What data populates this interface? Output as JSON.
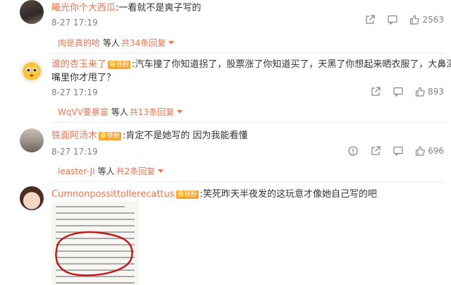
{
  "comments": [
    {
      "username": "曦光你个大西瓜",
      "has_badge": false,
      "separator": ":",
      "text": "一看就不是爽子写的",
      "time": "8-27 17:19",
      "likes": "2563",
      "reply_user": "肉是真的哈",
      "reply_mid": "等人",
      "reply_total": "共34条回复"
    },
    {
      "username": "谁的杏玉来了",
      "has_badge": true,
      "badge_label": "铁粉",
      "separator": ":",
      "text": "汽车撞了你知道拐了，股票涨了你知道买了，天黑了你想起来晒衣服了，大鼻涕流",
      "text_line2": "嘴里你才甩了？",
      "time": "8-27 17:19",
      "likes": "893",
      "reply_user": "WqVV要暴富",
      "reply_mid": "等人",
      "reply_total": "共13条回复"
    },
    {
      "username": "铁面阿汤木",
      "has_badge": true,
      "badge_label": "铁粉",
      "separator": ":",
      "text": "肯定不是她写的 因为我能看懂",
      "time": "8-27 17:19",
      "likes": "696",
      "reply_user": "leaster-JI",
      "reply_mid": "等人",
      "reply_total": "共2条回复"
    },
    {
      "username": "Cumnonpossittollerecattus",
      "has_badge": true,
      "badge_label": "铁粉",
      "separator": ":",
      "text": "笑死昨天半夜发的这玩意才像她自己写的吧"
    }
  ],
  "colors": {
    "username": "#eb7350",
    "meta": "#808080",
    "text": "#333333",
    "badge": "#f7a530"
  },
  "icons": [
    "share-icon",
    "comment-icon",
    "like-icon",
    "report-icon",
    "caret-down-icon"
  ]
}
